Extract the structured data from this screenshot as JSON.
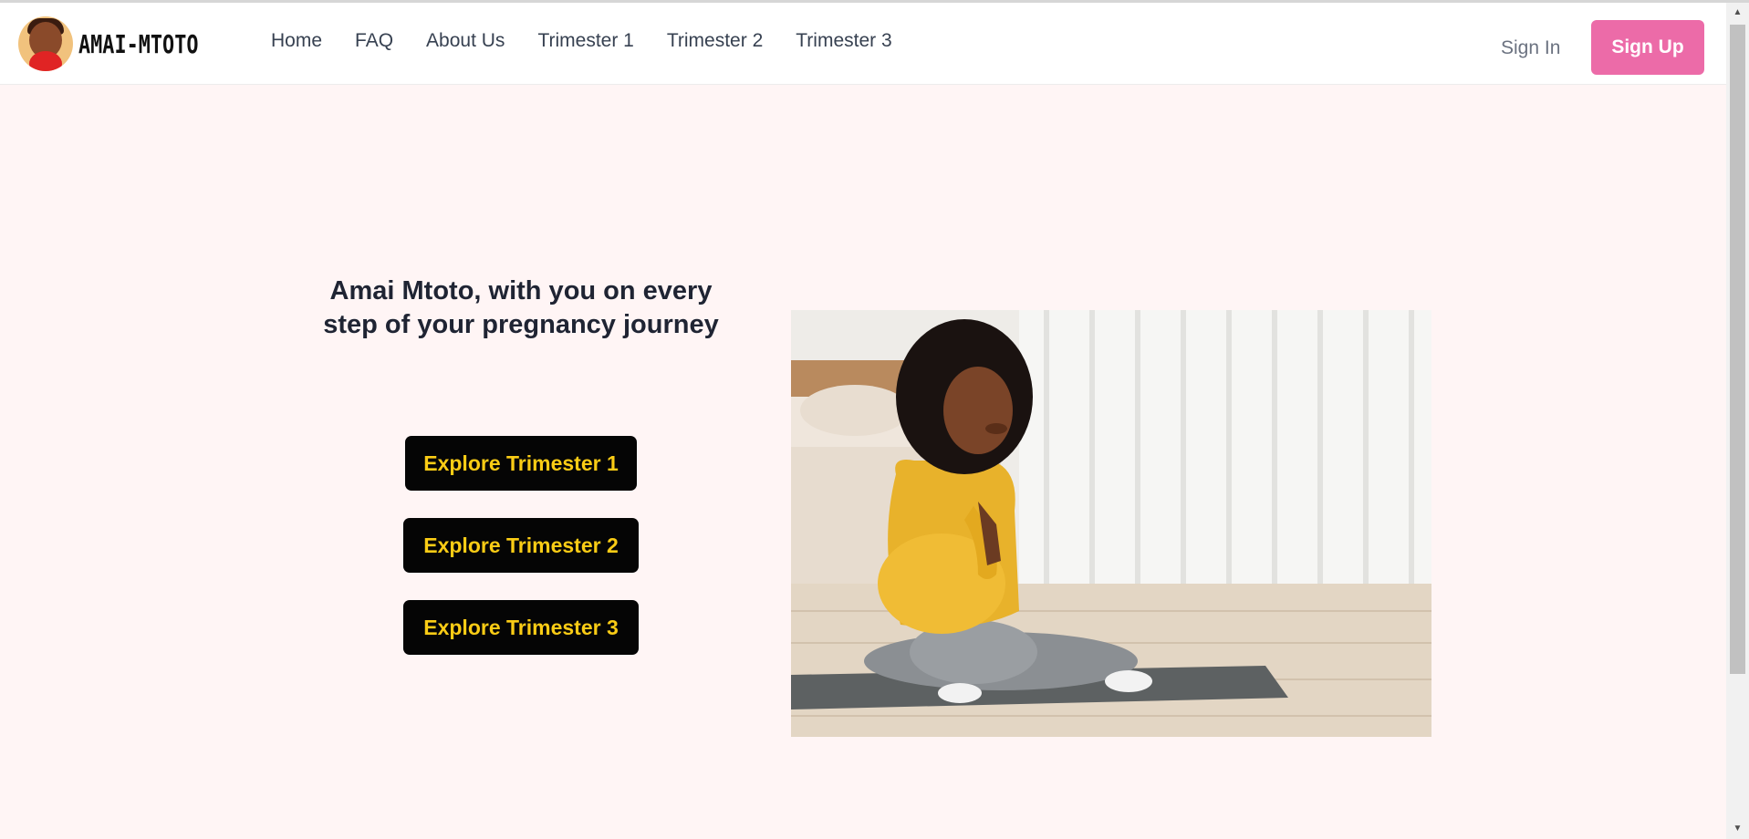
{
  "brand": {
    "name": "AMAI-MTOTO"
  },
  "nav": {
    "links": [
      "Home",
      "FAQ",
      "About Us",
      "Trimester 1",
      "Trimester 2",
      "Trimester 3"
    ]
  },
  "auth": {
    "sign_in": "Sign In",
    "sign_up": "Sign Up"
  },
  "hero": {
    "title": "Amai Mtoto, with you on every step of your pregnancy journey",
    "buttons": [
      "Explore Trimester 1",
      "Explore Trimester 2",
      "Explore Trimester 3"
    ]
  },
  "colors": {
    "page_background": "#fff5f5",
    "sign_up_button": "#ec6ba8",
    "explore_button": "#050505",
    "explore_text": "#facc15"
  }
}
